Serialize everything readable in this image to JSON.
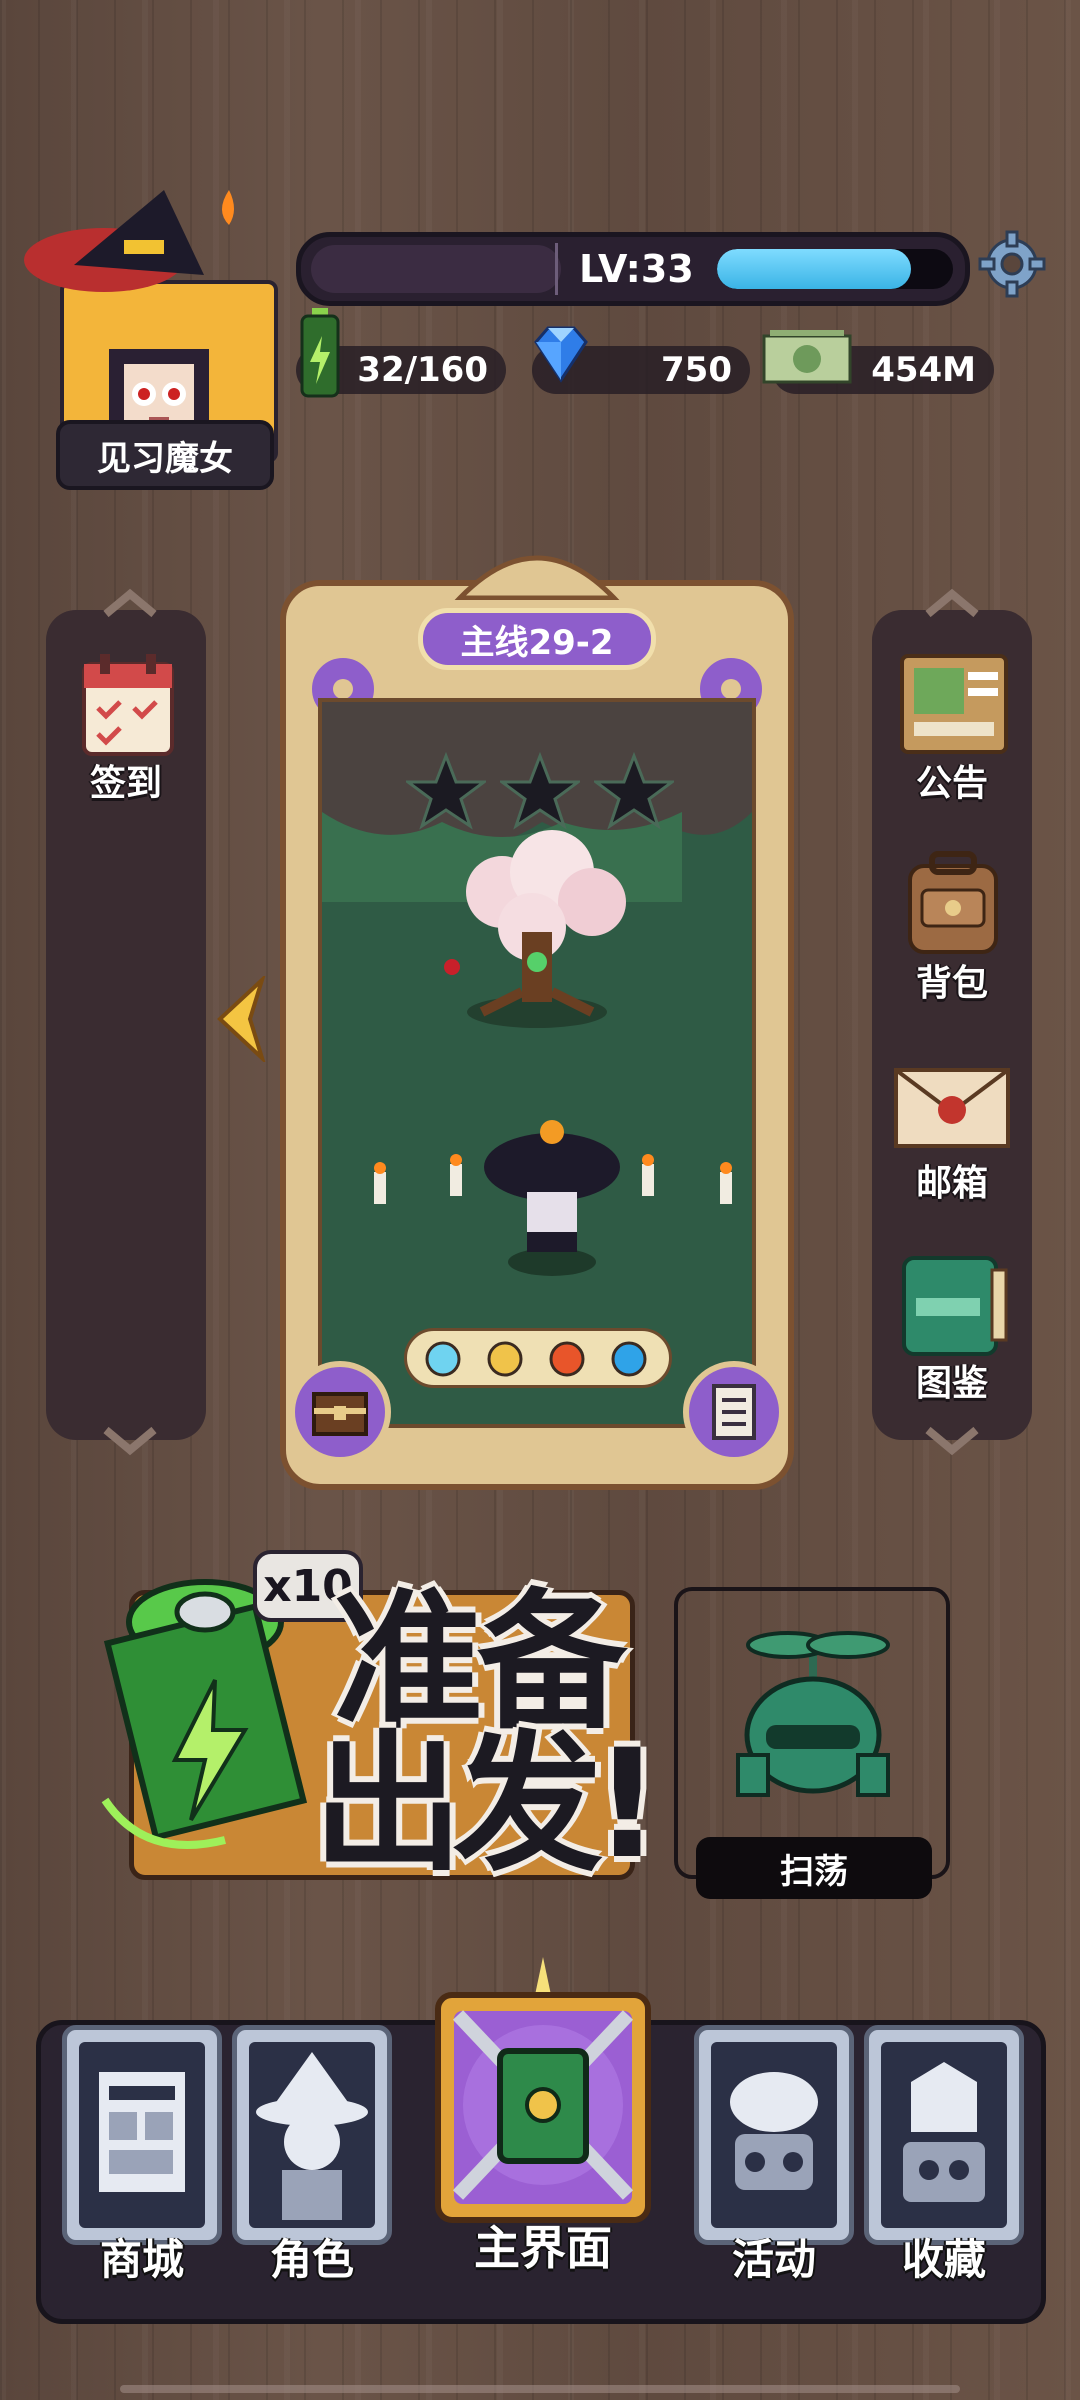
{
  "player": {
    "title": "见习魔女",
    "level_text": "LV:33",
    "xp_fraction": 0.82
  },
  "resources": {
    "energy": "32/160",
    "gems": "750",
    "cash": "454M"
  },
  "left_panel": {
    "items": [
      {
        "label": "签到",
        "icon": "calendar-icon"
      }
    ]
  },
  "right_panel": {
    "items": [
      {
        "label": "公告",
        "icon": "notice-board-icon"
      },
      {
        "label": "背包",
        "icon": "backpack-icon"
      },
      {
        "label": "邮箱",
        "icon": "mail-icon"
      },
      {
        "label": "图鉴",
        "icon": "book-icon"
      }
    ]
  },
  "stage": {
    "label": "主线29-2",
    "stars_earned": 0,
    "stars_total": 3,
    "elements": [
      "ice-icon",
      "gear-icon",
      "fire-icon",
      "water-icon"
    ]
  },
  "go_button": {
    "multiplier": "x10",
    "line1": "准备",
    "line2": "出发!"
  },
  "sweep": {
    "label": "扫荡"
  },
  "nav": {
    "tabs": [
      {
        "label": "商城",
        "icon": "shop-icon"
      },
      {
        "label": "角色",
        "icon": "character-icon"
      },
      {
        "label": "主界面",
        "icon": "spellbook-icon"
      },
      {
        "label": "活动",
        "icon": "event-icon"
      },
      {
        "label": "收藏",
        "icon": "collection-icon"
      }
    ]
  },
  "colors": {
    "accent_purple": "#8e5ecb",
    "xp_blue": "#3ab4e6",
    "gold_frame": "#e0c693",
    "nav_dark": "#2a2330"
  }
}
